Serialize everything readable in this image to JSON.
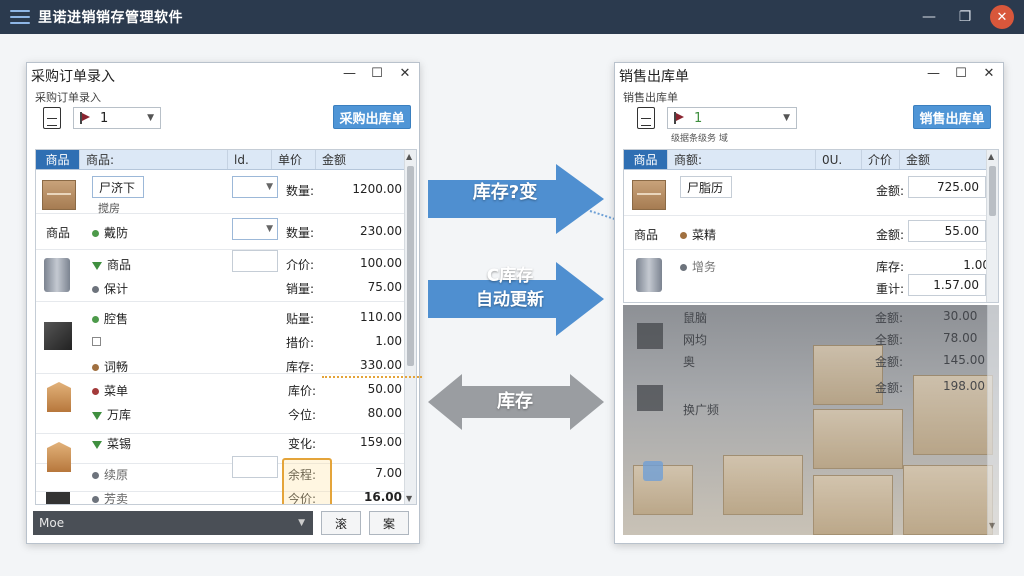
{
  "app": {
    "title": "里诺进销销存管理软件",
    "accent": "#2b3a4e",
    "close_icon": "close-icon"
  },
  "left": {
    "window_title": "采购订单录入",
    "subtitle": "采购订单录入",
    "combo_value": "1",
    "primary_button": "采购出库单",
    "columns": [
      "商品",
      "商品:",
      "ld.",
      "单价",
      "金额"
    ],
    "rows": [
      {
        "input": "尸济下",
        "sub": "搅房",
        "label": "数量:",
        "value": "1200.00"
      },
      {
        "name": "商品",
        "item": "戴防",
        "label": "数量:",
        "value": "230.00"
      },
      {
        "item1": "商品",
        "item2": "保计",
        "label1": "介价:",
        "value1": "100.00",
        "label2": "销量:",
        "value2": "75.00"
      },
      {
        "item1": "腔售",
        "item2": "",
        "item3": "词畅",
        "label1": "贴量:",
        "value1": "110.00",
        "label2": "措价:",
        "value2": "1.00",
        "label3": "库存:",
        "value3": "330.00"
      },
      {
        "item1": "菜单",
        "item2": "万库",
        "label1": "库价:",
        "value1": "50.00",
        "label2": "今位:",
        "value2": "80.00"
      },
      {
        "item1": "菜锡",
        "label1": "变化:",
        "value1": "159.00"
      },
      {
        "item1": "续原",
        "label1": "余程:",
        "value1": "7.00"
      },
      {
        "item1": "芳卖",
        "label1": "今价:",
        "value1": "16.00"
      }
    ],
    "footer_combo": "Moe",
    "footer_btn1": "滚",
    "footer_btn2": "案"
  },
  "arrows": {
    "top": "库存?变",
    "middle_line1": "C库存",
    "middle_line2": "自动更新",
    "bottom": "库存",
    "blue": "#4f8fd0",
    "grey": "#9a9da1"
  },
  "right": {
    "window_title": "销售出库单",
    "subtitle": "销售出库单",
    "combo_value": "1",
    "toolbar_caption": "级据条级务 域",
    "primary_button": "销售出库单",
    "columns": [
      "商品",
      "商额:",
      "0U.",
      "介价",
      "金额"
    ],
    "rows": [
      {
        "input": "尸脂历",
        "label": "金额:",
        "value": "725.00"
      },
      {
        "name": "商品",
        "item": "菜精",
        "label": "金额:",
        "value": "55.00"
      },
      {
        "item1": "增务",
        "label1": "库存:",
        "value1": "1.00",
        "label2": "重计:",
        "value2": "1.57.00"
      }
    ],
    "dim_rows": [
      {
        "item": "鼠脑",
        "label": "金额:",
        "value": "30.00"
      },
      {
        "item": "网均",
        "label": "全额:",
        "value": "78.00"
      },
      {
        "item": "奥",
        "label": "金额:",
        "value": "145.00"
      },
      {
        "item": "",
        "label": "金额:",
        "value": "198.00"
      },
      {
        "item": "换广频",
        "label": "",
        "value": ""
      }
    ]
  }
}
